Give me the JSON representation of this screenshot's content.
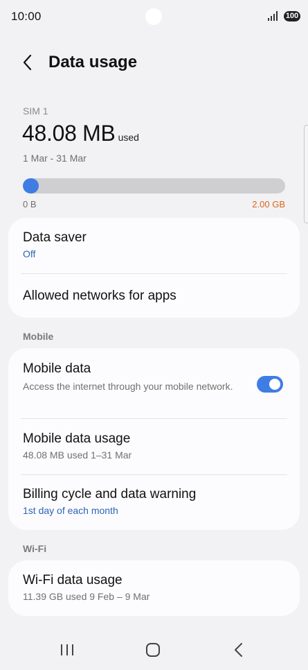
{
  "status_bar": {
    "time": "10:00",
    "battery": "100"
  },
  "header": {
    "title": "Data usage"
  },
  "usage": {
    "sim_label": "SIM 1",
    "value": "48.08 MB",
    "suffix": "used",
    "period": "1 Mar - 31 Mar",
    "progress_fraction": 0.06,
    "range_min": "0 B",
    "range_max": "2.00 GB"
  },
  "card1": {
    "data_saver": {
      "title": "Data saver",
      "value": "Off"
    },
    "allowed_networks": {
      "title": "Allowed networks for apps"
    }
  },
  "mobile_section": {
    "label": "Mobile",
    "mobile_data": {
      "title": "Mobile data",
      "description": "Access the internet through your mobile network.",
      "enabled": true
    },
    "mobile_data_usage": {
      "title": "Mobile data usage",
      "subtitle": "48.08 MB used 1–31 Mar"
    },
    "billing_cycle": {
      "title": "Billing cycle and data warning",
      "subtitle": "1st day of each month"
    }
  },
  "wifi_section": {
    "label": "Wi-Fi",
    "wifi_data_usage": {
      "title": "Wi-Fi data usage",
      "subtitle": "11.39 GB used 9 Feb – 9 Mar"
    }
  },
  "colors": {
    "accent": "#3f7de5",
    "warning": "#d9661d",
    "link": "#2e63b8"
  }
}
